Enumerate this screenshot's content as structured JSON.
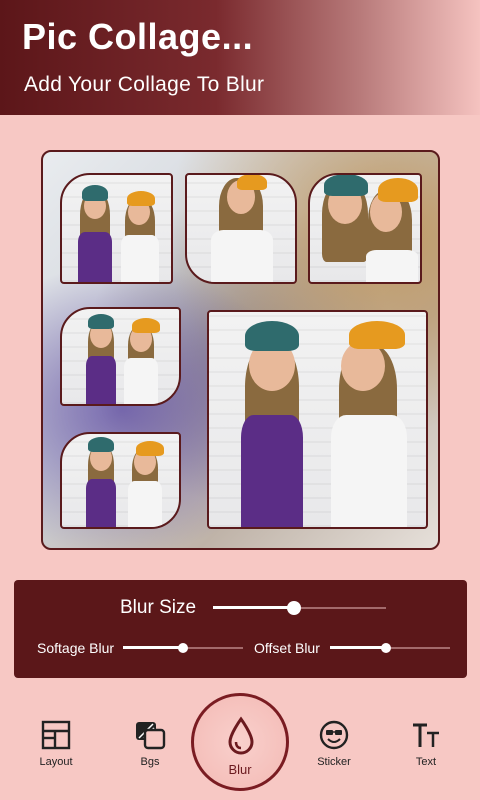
{
  "header": {
    "title": "Pic Collage...",
    "subtitle": "Add Your Collage To Blur"
  },
  "blur_panel": {
    "blur_size_label": "Blur Size",
    "blur_size_value": 0.47,
    "softage_label": "Softage Blur",
    "softage_value": 0.5,
    "offset_label": "Offset Blur",
    "offset_value": 0.47
  },
  "toolbar": {
    "layout_label": "Layout",
    "bgs_label": "Bgs",
    "blur_label": "Blur",
    "sticker_label": "Sticker",
    "text_label": "Text"
  },
  "colors": {
    "brand": "#5b1719",
    "background": "#f7c8c4",
    "accent": "#7a1c22"
  },
  "icons": [
    "layout-icon",
    "bgs-icon",
    "blur-drop-icon",
    "sticker-icon",
    "text-icon"
  ]
}
